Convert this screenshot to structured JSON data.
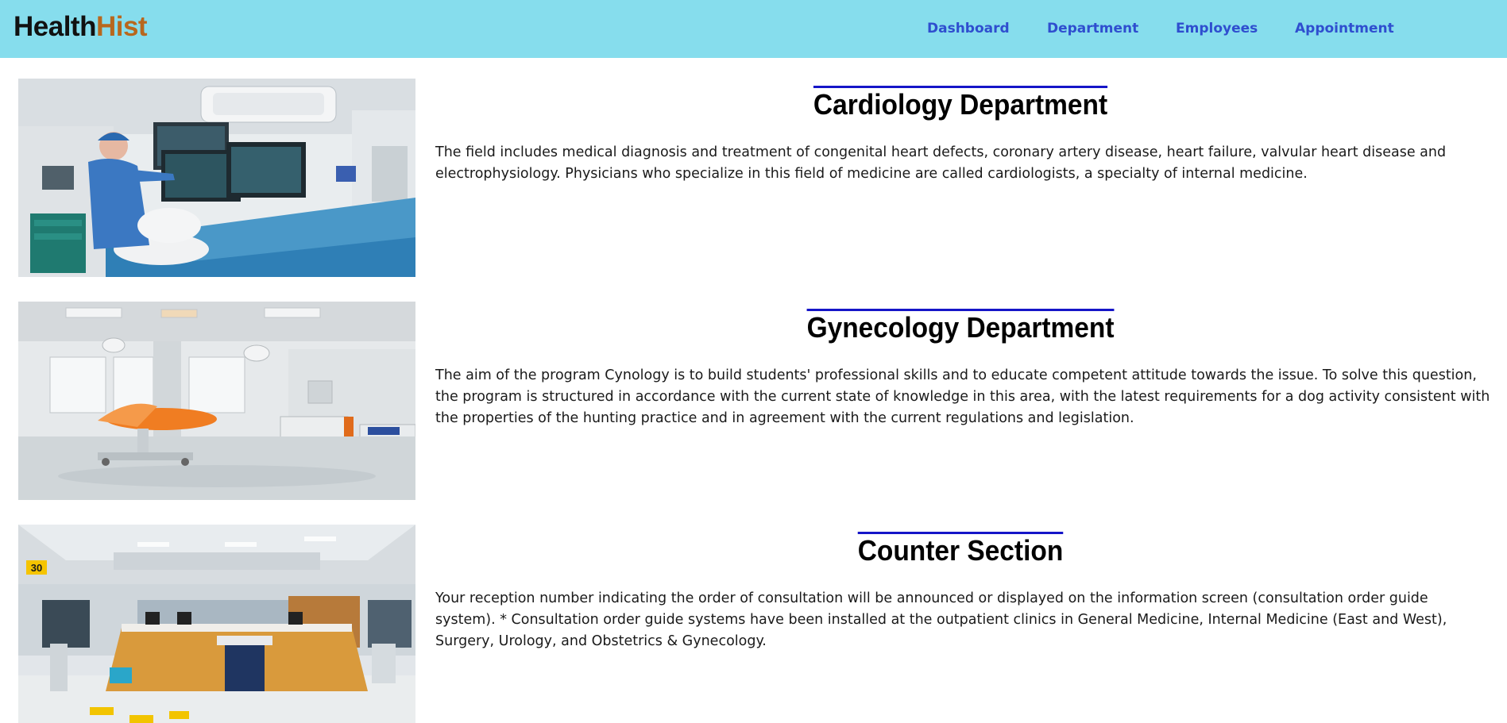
{
  "brand": {
    "part1": "Health",
    "part2": "Hist"
  },
  "nav": [
    {
      "label": "Dashboard"
    },
    {
      "label": "Department"
    },
    {
      "label": "Employees"
    },
    {
      "label": "Appointment"
    }
  ],
  "sections": [
    {
      "title": "Cardiology Department",
      "description": "The field includes medical diagnosis and treatment of congenital heart defects, coronary artery disease, heart failure, valvular heart disease and electrophysiology. Physicians who specialize in this field of medicine are called cardiologists, a specialty of internal medicine."
    },
    {
      "title": "Gynecology Department",
      "description": "The aim of the program Cynology is to build students' professional skills and to educate competent attitude towards the issue. To solve this question, the program is structured in accordance with the current state of knowledge in this area, with the latest requirements for a dog activity consistent with the properties of the hunting practice and in agreement with the current regulations and legislation."
    },
    {
      "title": "Counter Section",
      "description": "Your reception number indicating the order of consultation will be announced or displayed on the information screen (consultation order guide system). * Consultation order guide systems have been installed at the outpatient clinics in General Medicine, Internal Medicine (East and West), Surgery, Urology, and Obstetrics & Gynecology."
    }
  ],
  "images": {
    "counter_sign": "30"
  },
  "colors": {
    "navbar_bg": "#86dded",
    "brand_dark": "#111111",
    "brand_accent": "#b8671d",
    "nav_link": "#2f4ecf",
    "heading_rule": "#1515c8"
  }
}
